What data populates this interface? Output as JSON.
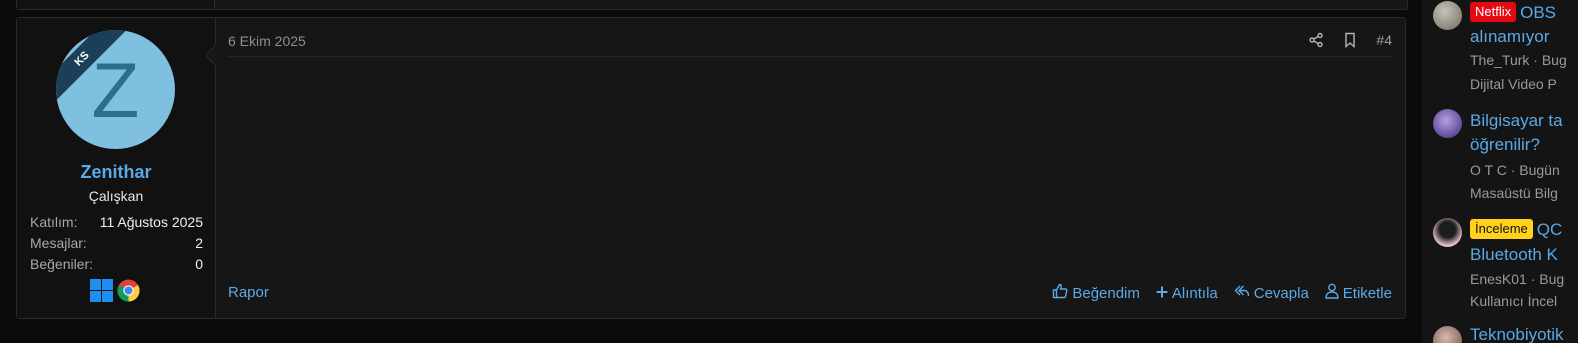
{
  "post": {
    "date": "6 Ekim 2025",
    "number": "#4",
    "user": {
      "avatar_letter": "Z",
      "ribbon": "KS",
      "name": "Zenithar",
      "title": "Çalışkan",
      "stats": [
        {
          "label": "Katılım:",
          "value": "11 Ağustos 2025"
        },
        {
          "label": "Mesajlar:",
          "value": "2"
        },
        {
          "label": "Beğeniler:",
          "value": "0"
        }
      ]
    },
    "report_label": "Rapor",
    "actions": {
      "like": "Beğendim",
      "quote": "Alıntıla",
      "reply": "Cevapla",
      "tag": "Etiketle"
    }
  },
  "sidebar": {
    "items": [
      {
        "badge": "Netflix",
        "title_1": "OBS",
        "title_2": "alınamıyor",
        "meta": "The_Turk · Bug",
        "forum": "Dijital Video P"
      },
      {
        "title_1": "Bilgisayar ta",
        "title_2": "öğrenilir?",
        "meta": "O T C · Bugün",
        "forum": "Masaüstü Bilg"
      },
      {
        "badge": "İnceleme",
        "title_1": "QC",
        "title_2": "Bluetooth K",
        "meta": "EnesK01 · Bug",
        "forum": "Kullanıcı İncel"
      },
      {
        "title_1": "Teknobiyotik"
      }
    ]
  },
  "colors": {
    "accent": "#5aa9e6",
    "netflix": "#e50914",
    "inceleme": "#ffd11a",
    "avatar_bg": "#7fbfdf"
  }
}
